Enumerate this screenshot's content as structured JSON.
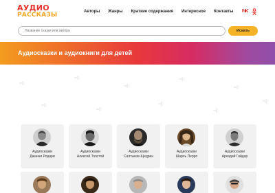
{
  "logo": {
    "line1": "АУДИО",
    "line2": "РАССКАЗЫ"
  },
  "nav": [
    {
      "label": "Авторы"
    },
    {
      "label": "Жанры"
    },
    {
      "label": "Краткие содержания"
    },
    {
      "label": "Интересное"
    },
    {
      "label": "Контакты"
    }
  ],
  "social": {
    "vk": "ВК",
    "ok": "ok-icon"
  },
  "search": {
    "placeholder": "Название сказки или автора",
    "button": "Искать"
  },
  "banner": {
    "title": "Аудиосказки и аудиокниги для детей"
  },
  "colors": {
    "accent": "#f5b327",
    "logo_red": "#e8302a",
    "gradient_start": "#f39c1f",
    "gradient_end": "#8f4fab"
  },
  "authors": [
    {
      "line1": "Аудиосказки",
      "line2": "Джанни Родари"
    },
    {
      "line1": "Аудиосказки",
      "line2": "Алексей Толстой"
    },
    {
      "line1": "Аудиосказки",
      "line2": "Салтыков-Щедрин"
    },
    {
      "line1": "Аудиосказки",
      "line2": "Шарль Перро"
    },
    {
      "line1": "Аудиосказки",
      "line2": "Аркадий Гайдар"
    }
  ]
}
